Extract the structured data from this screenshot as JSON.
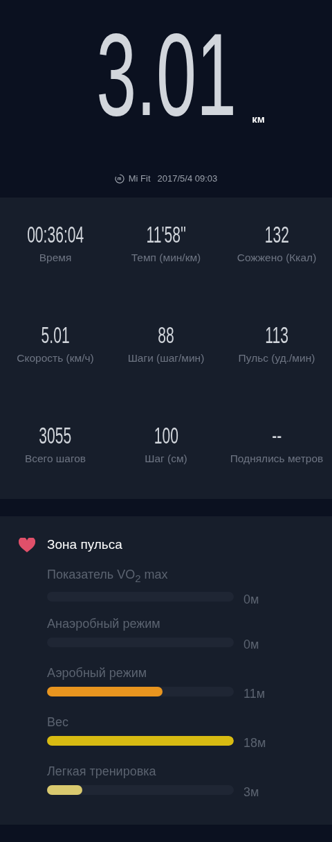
{
  "distance": {
    "value": "3.01",
    "unit": "км"
  },
  "source": {
    "app": "Mi Fit",
    "datetime": "2017/5/4 09:03"
  },
  "stats": [
    {
      "value": "00:36:04",
      "label": "Время"
    },
    {
      "value": "11'58''",
      "label": "Темп (мин/км)"
    },
    {
      "value": "132",
      "label": "Сожжено (Ккал)"
    },
    {
      "value": "5.01",
      "label": "Скорость (км/ч)"
    },
    {
      "value": "88",
      "label": "Шаги (шаг/мин)"
    },
    {
      "value": "113",
      "label": "Пульс (уд./мин)"
    },
    {
      "value": "3055",
      "label": "Всего шагов"
    },
    {
      "value": "100",
      "label": "Шаг (см)"
    },
    {
      "value": "--",
      "label": "Поднялись метров"
    }
  ],
  "heart_zones": {
    "title": "Зона пульса",
    "zones": [
      {
        "label": "Показатель VO$_{2}$ max",
        "reading": "0м"
      },
      {
        "label": "Анаэробный режим",
        "reading": "0м"
      },
      {
        "label": "Аэробный режим",
        "level": 0.62,
        "reading": "11м",
        "color": "#e8951f"
      },
      {
        "label": "Вес",
        "level": 1,
        "reading": "18м",
        "color": "#d8bb12"
      },
      {
        "label": "Легкая тренировка",
        "level": 0.19,
        "reading": "3м",
        "color": "#d9c96f"
      }
    ]
  }
}
